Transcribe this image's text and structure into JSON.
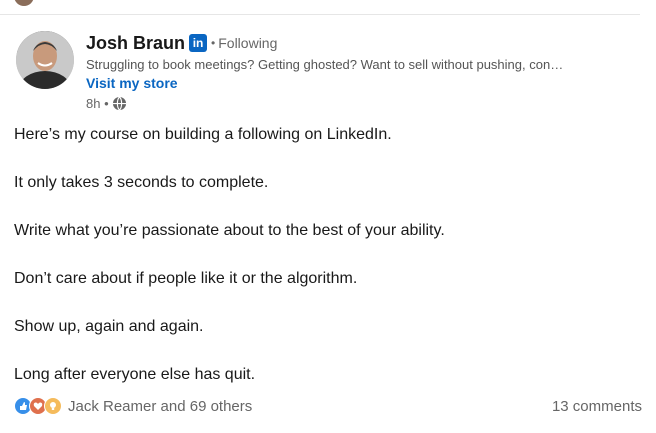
{
  "post": {
    "author": {
      "name": "Josh Braun",
      "badge": "in",
      "separator": "•",
      "follow_status": "Following",
      "headline": "Struggling to book meetings? Getting ghosted? Want to sell without pushing, con…",
      "store_link": "Visit my store",
      "time": "8h •",
      "avatar_icon": "avatar-photo",
      "visibility_icon": "globe-icon"
    },
    "body": [
      "Here’s my course on building a following on LinkedIn.",
      "It only takes 3 seconds to complete.",
      "Write what you’re passionate about to the best of your ability.",
      "Don’t care about if people like it or the algorithm.",
      "Show up, again and again.",
      "Long after everyone else has quit."
    ],
    "reactions": {
      "icons": [
        "like-icon",
        "love-icon",
        "insightful-icon"
      ],
      "summary": "Jack Reamer and 69 others"
    },
    "comments": "13 comments"
  },
  "colors": {
    "brand": "#0a66c2",
    "text": "#191919",
    "muted": "#666666",
    "like": "#378fe9",
    "love": "#df704d",
    "insightful": "#f5bb5c"
  }
}
